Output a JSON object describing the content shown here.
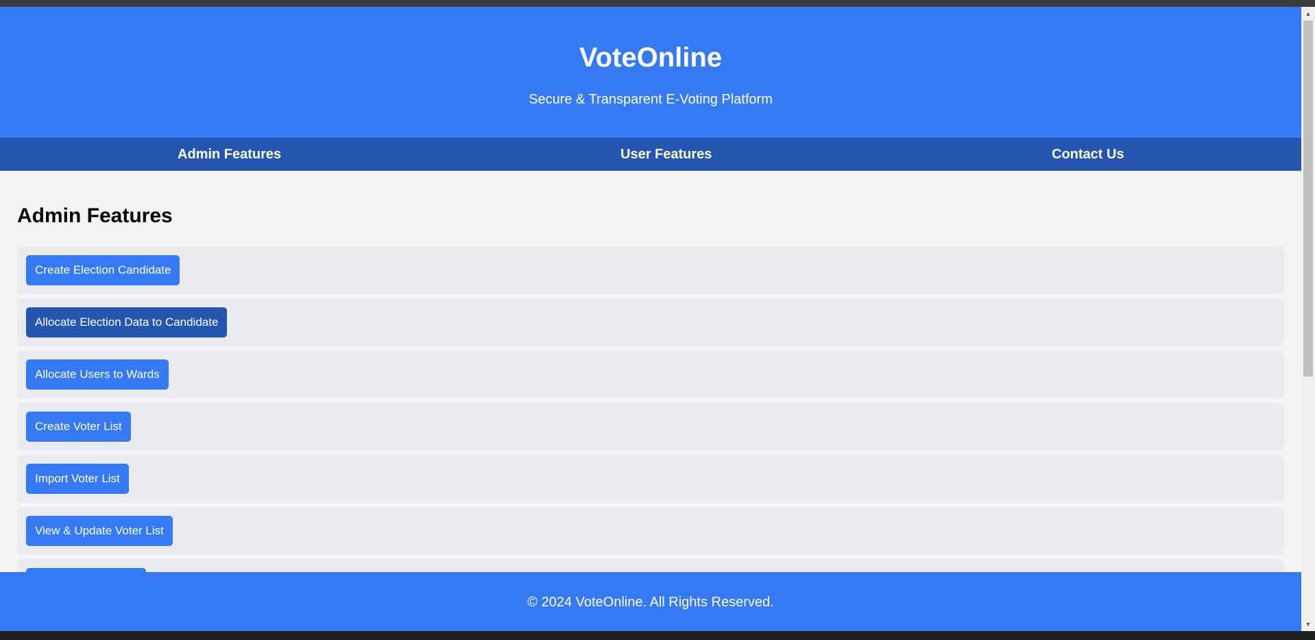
{
  "header": {
    "title": "VoteOnline",
    "subtitle": "Secure & Transparent E-Voting Platform"
  },
  "nav": {
    "items": [
      {
        "label": "Admin Features"
      },
      {
        "label": "User Features"
      },
      {
        "label": "Contact Us"
      }
    ]
  },
  "main": {
    "section_title": "Admin Features",
    "features": [
      {
        "label": "Create Election Candidate"
      },
      {
        "label": "Allocate Election Data to Candidate"
      },
      {
        "label": "Allocate Users to Wards"
      },
      {
        "label": "Create Voter List"
      },
      {
        "label": "Import Voter List"
      },
      {
        "label": "View & Update Voter List"
      },
      {
        "label": ""
      }
    ]
  },
  "footer": {
    "text": "© 2024 VoteOnline. All Rights Reserved."
  },
  "colors": {
    "primary": "#3679f5",
    "primary_dark": "#2456b0",
    "background": "#f4f4f4",
    "row_background": "#e9ebee"
  },
  "icons": {
    "scroll_up": "triangle-up-icon",
    "scroll_down": "triangle-down-icon"
  }
}
